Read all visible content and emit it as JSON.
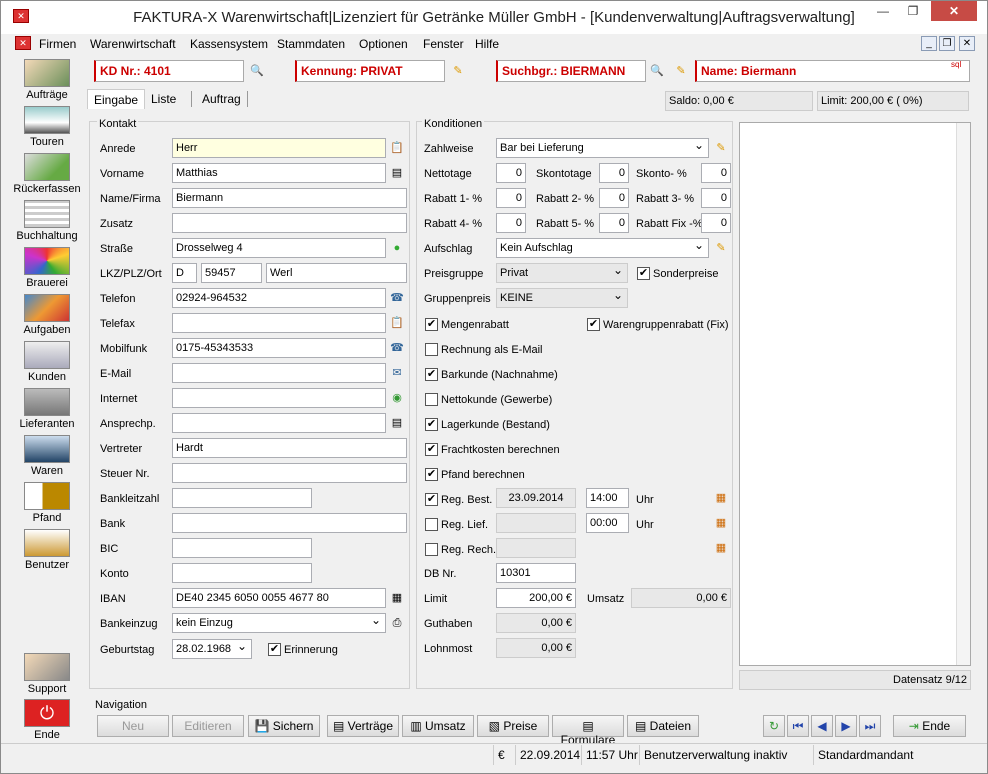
{
  "window": {
    "title": "FAKTURA-X Warenwirtschaft|Lizenziert für Getränke Müller GmbH - [Kundenverwaltung|Auftragsverwaltung]"
  },
  "menu": [
    "Firmen",
    "Warenwirtschaft",
    "Kassensystem",
    "Stammdaten",
    "Optionen",
    "Fenster",
    "Hilfe"
  ],
  "sidebar": [
    "Aufträge",
    "Touren",
    "Rückerfassen",
    "Buchhaltung",
    "Brauerei",
    "Aufgaben",
    "Kunden",
    "Lieferanten",
    "Waren",
    "Pfand",
    "Benutzer",
    "Support",
    "Ende"
  ],
  "header": {
    "kdnr": "KD Nr.: 4101",
    "kennung": "Kennung: PRIVAT",
    "suchbgr": "Suchbgr.: BIERMANN",
    "name": "Name: Biermann",
    "sql": "sql"
  },
  "tabs": [
    "Eingabe",
    "Liste",
    "Auftrag"
  ],
  "saldo": "Saldo: 0,00 €",
  "limit": "Limit: 200,00 € ( 0%)",
  "kontakt": {
    "title": "Kontakt",
    "labels": [
      "Anrede",
      "Vorname",
      "Name/Firma",
      "Zusatz",
      "Straße",
      "LKZ/PLZ/Ort",
      "Telefon",
      "Telefax",
      "Mobilfunk",
      "E-Mail",
      "Internet",
      "Ansprechp.",
      "Vertreter",
      "Steuer Nr.",
      "Bankleitzahl",
      "Bank",
      "BIC",
      "Konto",
      "IBAN",
      "Bankeinzug",
      "Geburtstag"
    ],
    "anrede": "Herr",
    "vorname": "Matthias",
    "name": "Biermann",
    "zusatz": "",
    "strasse": "Drosselweg 4",
    "lkz": "D",
    "plz": "59457",
    "ort": "Werl",
    "telefon": "02924-964532",
    "telefax": "",
    "mobil": "0175-45343533",
    "email": "",
    "internet": "",
    "ansprechp": "",
    "vertreter": "Hardt",
    "steuer": "",
    "blz": "",
    "bank": "",
    "bic": "",
    "konto": "",
    "iban": "DE40 2345 6050 0055 4677 80",
    "bankeinzug": "kein Einzug",
    "geburtstag": "28.02.1968",
    "erinnerung": "Erinnerung"
  },
  "konditionen": {
    "title": "Konditionen",
    "zahlweise_l": "Zahlweise",
    "zahlweise": "Bar bei Lieferung",
    "nettotage_l": "Nettotage",
    "nettotage": "0",
    "skontotage_l": "Skontotage",
    "skontotage": "0",
    "skonto_l": "Skonto- %",
    "skonto": "0",
    "r1_l": "Rabatt 1- %",
    "r1": "0",
    "r2_l": "Rabatt 2- %",
    "r2": "0",
    "r3_l": "Rabatt 3- %",
    "r3": "0",
    "r4_l": "Rabatt 4- %",
    "r4": "0",
    "r5_l": "Rabatt 5- %",
    "r5": "0",
    "rfix_l": "Rabatt Fix -%",
    "rfix": "0",
    "aufschlag_l": "Aufschlag",
    "aufschlag": "Kein Aufschlag",
    "preisgruppe_l": "Preisgruppe",
    "preisgruppe": "Privat",
    "sonderpreise": "Sonderpreise",
    "gruppenpreis_l": "Gruppenpreis",
    "gruppenpreis": "KEINE",
    "checks": [
      {
        "label": "Mengenrabatt",
        "checked": true
      },
      {
        "label": "Rechnung als E-Mail",
        "checked": false
      },
      {
        "label": "Barkunde (Nachnahme)",
        "checked": true
      },
      {
        "label": "Nettokunde (Gewerbe)",
        "checked": false
      },
      {
        "label": "Lagerkunde (Bestand)",
        "checked": true
      },
      {
        "label": "Frachtkosten berechnen",
        "checked": true
      },
      {
        "label": "Pfand berechnen",
        "checked": true
      }
    ],
    "warengruppe": "Warengruppenrabatt (Fix)",
    "regbest": "Reg. Best.",
    "regbest_date": "23.09.2014",
    "regbest_time": "14:00",
    "uhr": "Uhr",
    "reglief": "Reg. Lief.",
    "reglief_time": "00:00",
    "regrech": "Reg. Rech.",
    "dbnr_l": "DB Nr.",
    "dbnr": "10301",
    "limit_l": "Limit",
    "limit": "200,00 €",
    "umsatz_l": "Umsatz",
    "umsatz": "0,00 €",
    "guthaben_l": "Guthaben",
    "guthaben": "0,00 €",
    "lohnmost_l": "Lohnmost",
    "lohnmost": "0,00 €"
  },
  "datensatz": "Datensatz 9/12",
  "navigation": "Navigation",
  "buttons": [
    "Neu",
    "Editieren",
    "Sichern",
    "Verträge",
    "Umsatz",
    "Preise",
    "Formulare",
    "Dateien",
    "Ende"
  ],
  "status": {
    "currency": "€",
    "date": "22.09.2014",
    "time": "11:57 Uhr",
    "user": "Benutzerverwaltung inaktiv",
    "mandant": "Standardmandant"
  }
}
